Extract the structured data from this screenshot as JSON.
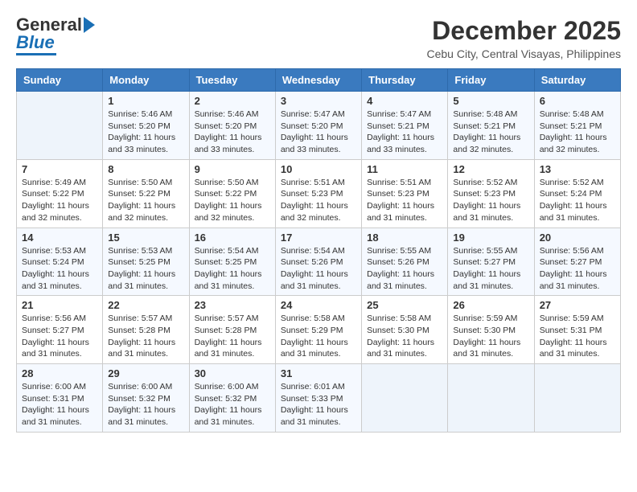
{
  "header": {
    "logo_line1": "General",
    "logo_line2": "Blue",
    "month": "December 2025",
    "location": "Cebu City, Central Visayas, Philippines"
  },
  "weekdays": [
    "Sunday",
    "Monday",
    "Tuesday",
    "Wednesday",
    "Thursday",
    "Friday",
    "Saturday"
  ],
  "weeks": [
    [
      {
        "num": "",
        "info": ""
      },
      {
        "num": "1",
        "info": "Sunrise: 5:46 AM\nSunset: 5:20 PM\nDaylight: 11 hours\nand 33 minutes."
      },
      {
        "num": "2",
        "info": "Sunrise: 5:46 AM\nSunset: 5:20 PM\nDaylight: 11 hours\nand 33 minutes."
      },
      {
        "num": "3",
        "info": "Sunrise: 5:47 AM\nSunset: 5:20 PM\nDaylight: 11 hours\nand 33 minutes."
      },
      {
        "num": "4",
        "info": "Sunrise: 5:47 AM\nSunset: 5:21 PM\nDaylight: 11 hours\nand 33 minutes."
      },
      {
        "num": "5",
        "info": "Sunrise: 5:48 AM\nSunset: 5:21 PM\nDaylight: 11 hours\nand 32 minutes."
      },
      {
        "num": "6",
        "info": "Sunrise: 5:48 AM\nSunset: 5:21 PM\nDaylight: 11 hours\nand 32 minutes."
      }
    ],
    [
      {
        "num": "7",
        "info": "Sunrise: 5:49 AM\nSunset: 5:22 PM\nDaylight: 11 hours\nand 32 minutes."
      },
      {
        "num": "8",
        "info": "Sunrise: 5:50 AM\nSunset: 5:22 PM\nDaylight: 11 hours\nand 32 minutes."
      },
      {
        "num": "9",
        "info": "Sunrise: 5:50 AM\nSunset: 5:22 PM\nDaylight: 11 hours\nand 32 minutes."
      },
      {
        "num": "10",
        "info": "Sunrise: 5:51 AM\nSunset: 5:23 PM\nDaylight: 11 hours\nand 32 minutes."
      },
      {
        "num": "11",
        "info": "Sunrise: 5:51 AM\nSunset: 5:23 PM\nDaylight: 11 hours\nand 31 minutes."
      },
      {
        "num": "12",
        "info": "Sunrise: 5:52 AM\nSunset: 5:23 PM\nDaylight: 11 hours\nand 31 minutes."
      },
      {
        "num": "13",
        "info": "Sunrise: 5:52 AM\nSunset: 5:24 PM\nDaylight: 11 hours\nand 31 minutes."
      }
    ],
    [
      {
        "num": "14",
        "info": "Sunrise: 5:53 AM\nSunset: 5:24 PM\nDaylight: 11 hours\nand 31 minutes."
      },
      {
        "num": "15",
        "info": "Sunrise: 5:53 AM\nSunset: 5:25 PM\nDaylight: 11 hours\nand 31 minutes."
      },
      {
        "num": "16",
        "info": "Sunrise: 5:54 AM\nSunset: 5:25 PM\nDaylight: 11 hours\nand 31 minutes."
      },
      {
        "num": "17",
        "info": "Sunrise: 5:54 AM\nSunset: 5:26 PM\nDaylight: 11 hours\nand 31 minutes."
      },
      {
        "num": "18",
        "info": "Sunrise: 5:55 AM\nSunset: 5:26 PM\nDaylight: 11 hours\nand 31 minutes."
      },
      {
        "num": "19",
        "info": "Sunrise: 5:55 AM\nSunset: 5:27 PM\nDaylight: 11 hours\nand 31 minutes."
      },
      {
        "num": "20",
        "info": "Sunrise: 5:56 AM\nSunset: 5:27 PM\nDaylight: 11 hours\nand 31 minutes."
      }
    ],
    [
      {
        "num": "21",
        "info": "Sunrise: 5:56 AM\nSunset: 5:27 PM\nDaylight: 11 hours\nand 31 minutes."
      },
      {
        "num": "22",
        "info": "Sunrise: 5:57 AM\nSunset: 5:28 PM\nDaylight: 11 hours\nand 31 minutes."
      },
      {
        "num": "23",
        "info": "Sunrise: 5:57 AM\nSunset: 5:28 PM\nDaylight: 11 hours\nand 31 minutes."
      },
      {
        "num": "24",
        "info": "Sunrise: 5:58 AM\nSunset: 5:29 PM\nDaylight: 11 hours\nand 31 minutes."
      },
      {
        "num": "25",
        "info": "Sunrise: 5:58 AM\nSunset: 5:30 PM\nDaylight: 11 hours\nand 31 minutes."
      },
      {
        "num": "26",
        "info": "Sunrise: 5:59 AM\nSunset: 5:30 PM\nDaylight: 11 hours\nand 31 minutes."
      },
      {
        "num": "27",
        "info": "Sunrise: 5:59 AM\nSunset: 5:31 PM\nDaylight: 11 hours\nand 31 minutes."
      }
    ],
    [
      {
        "num": "28",
        "info": "Sunrise: 6:00 AM\nSunset: 5:31 PM\nDaylight: 11 hours\nand 31 minutes."
      },
      {
        "num": "29",
        "info": "Sunrise: 6:00 AM\nSunset: 5:32 PM\nDaylight: 11 hours\nand 31 minutes."
      },
      {
        "num": "30",
        "info": "Sunrise: 6:00 AM\nSunset: 5:32 PM\nDaylight: 11 hours\nand 31 minutes."
      },
      {
        "num": "31",
        "info": "Sunrise: 6:01 AM\nSunset: 5:33 PM\nDaylight: 11 hours\nand 31 minutes."
      },
      {
        "num": "",
        "info": ""
      },
      {
        "num": "",
        "info": ""
      },
      {
        "num": "",
        "info": ""
      }
    ]
  ]
}
